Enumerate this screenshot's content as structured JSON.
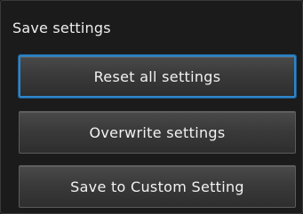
{
  "screen": {
    "title": "Save settings"
  },
  "menu": {
    "items": [
      {
        "label": "Reset all settings",
        "selected": true
      },
      {
        "label": "Overwrite settings",
        "selected": false
      },
      {
        "label": "Save to Custom Setting",
        "selected": false
      }
    ]
  },
  "colors": {
    "background": "#1b1b1b",
    "button": "#3a3a3a",
    "selection_border": "#2f86c9",
    "text": "#f2f2f2"
  }
}
